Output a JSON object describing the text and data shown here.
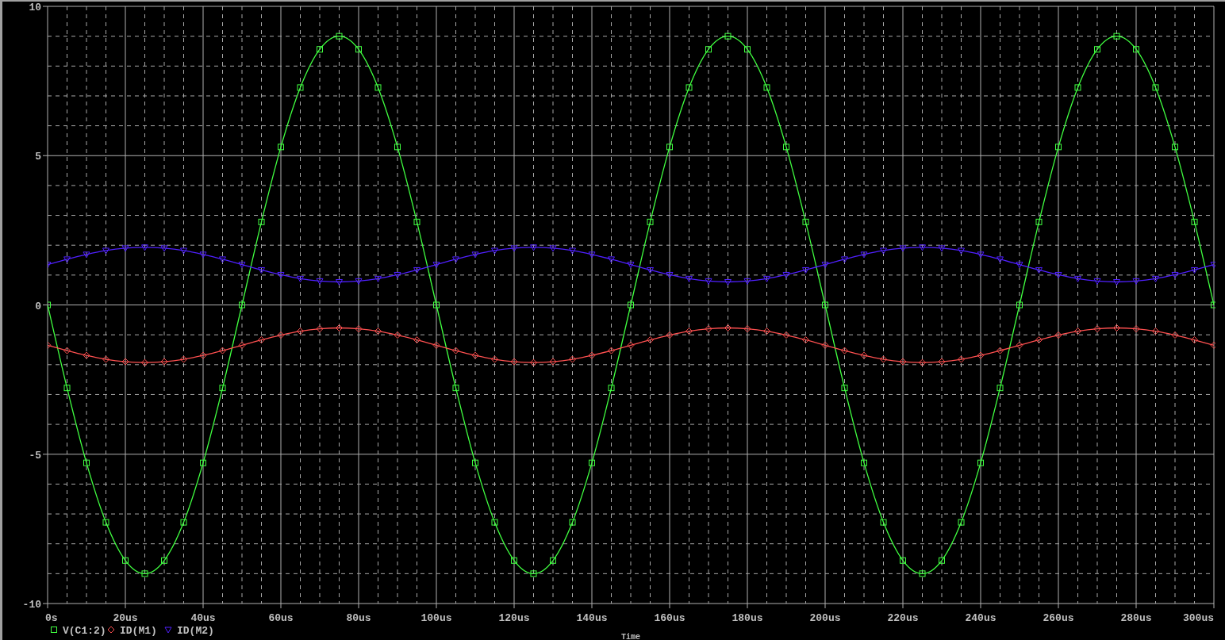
{
  "chart_data": {
    "type": "line",
    "grid": true,
    "legend": "bottom-left",
    "xlabel": "Time",
    "xlim": [
      0,
      300
    ],
    "ylim": [
      -10,
      10
    ],
    "xticks": [
      {
        "value": 0,
        "label": "0s"
      },
      {
        "value": 20,
        "label": "20us"
      },
      {
        "value": 40,
        "label": "40us"
      },
      {
        "value": 60,
        "label": "60us"
      },
      {
        "value": 80,
        "label": "80us"
      },
      {
        "value": 100,
        "label": "100us"
      },
      {
        "value": 120,
        "label": "120us"
      },
      {
        "value": 140,
        "label": "140us"
      },
      {
        "value": 160,
        "label": "160us"
      },
      {
        "value": 180,
        "label": "180us"
      },
      {
        "value": 200,
        "label": "200us"
      },
      {
        "value": 220,
        "label": "220us"
      },
      {
        "value": 240,
        "label": "240us"
      },
      {
        "value": 260,
        "label": "260us"
      },
      {
        "value": 280,
        "label": "280us"
      },
      {
        "value": 300,
        "label": "300us"
      }
    ],
    "yticks": [
      -10,
      -5,
      0,
      5,
      10
    ],
    "x": [
      0,
      5,
      10,
      15,
      20,
      25,
      30,
      35,
      40,
      45,
      50,
      55,
      60,
      65,
      70,
      75,
      80,
      85,
      90,
      95,
      100,
      105,
      110,
      115,
      120,
      125,
      130,
      135,
      140,
      145,
      150,
      155,
      160,
      165,
      170,
      175,
      180,
      185,
      190,
      195,
      200,
      205,
      210,
      215,
      220,
      225,
      230,
      235,
      240,
      245,
      250,
      255,
      260,
      265,
      270,
      275,
      280,
      285,
      290,
      295,
      300
    ],
    "series": [
      {
        "name": "V(C1:2)",
        "color": "#40ff40",
        "marker": "square",
        "values": [
          0,
          -2.78,
          -5.29,
          -7.28,
          -8.56,
          -9,
          -8.56,
          -7.28,
          -5.29,
          -2.78,
          0,
          2.78,
          5.29,
          7.28,
          8.56,
          9,
          8.56,
          7.28,
          5.29,
          2.78,
          0,
          -2.78,
          -5.29,
          -7.28,
          -8.56,
          -9,
          -8.56,
          -7.28,
          -5.29,
          -2.78,
          0,
          2.78,
          5.29,
          7.28,
          8.56,
          9,
          8.56,
          7.28,
          5.29,
          2.78,
          0,
          -2.78,
          -5.29,
          -7.28,
          -8.56,
          -9,
          -8.56,
          -7.28,
          -5.29,
          -2.78,
          0,
          2.78,
          5.29,
          7.28,
          8.56,
          9,
          8.56,
          7.28,
          5.29,
          2.78,
          0
        ]
      },
      {
        "name": "ID(M1)",
        "color": "#ff5050",
        "marker": "diamond",
        "values": [
          -1.35,
          -1.53,
          -1.69,
          -1.82,
          -1.9,
          -1.93,
          -1.9,
          -1.82,
          -1.69,
          -1.53,
          -1.35,
          -1.17,
          -1.01,
          -0.88,
          -0.8,
          -0.77,
          -0.8,
          -0.88,
          -1.01,
          -1.17,
          -1.35,
          -1.53,
          -1.69,
          -1.82,
          -1.9,
          -1.93,
          -1.9,
          -1.82,
          -1.69,
          -1.53,
          -1.35,
          -1.17,
          -1.01,
          -0.88,
          -0.8,
          -0.77,
          -0.8,
          -0.88,
          -1.01,
          -1.17,
          -1.35,
          -1.53,
          -1.69,
          -1.82,
          -1.9,
          -1.93,
          -1.9,
          -1.82,
          -1.69,
          -1.53,
          -1.35,
          -1.17,
          -1.01,
          -0.88,
          -0.8,
          -0.77,
          -0.8,
          -0.88,
          -1.01,
          -1.17,
          -1.35
        ]
      },
      {
        "name": "ID(M2)",
        "color": "#5020ff",
        "marker": "triangle",
        "values": [
          1.35,
          1.53,
          1.69,
          1.82,
          1.9,
          1.93,
          1.9,
          1.82,
          1.69,
          1.53,
          1.35,
          1.17,
          1.01,
          0.88,
          0.8,
          0.77,
          0.8,
          0.88,
          1.01,
          1.17,
          1.35,
          1.53,
          1.69,
          1.82,
          1.9,
          1.93,
          1.9,
          1.82,
          1.69,
          1.53,
          1.35,
          1.17,
          1.01,
          0.88,
          0.8,
          0.77,
          0.8,
          0.88,
          1.01,
          1.17,
          1.35,
          1.53,
          1.69,
          1.82,
          1.9,
          1.93,
          1.9,
          1.82,
          1.69,
          1.53,
          1.35,
          1.17,
          1.01,
          0.88,
          0.8,
          0.77,
          0.8,
          0.88,
          1.01,
          1.17,
          1.35
        ]
      }
    ]
  }
}
